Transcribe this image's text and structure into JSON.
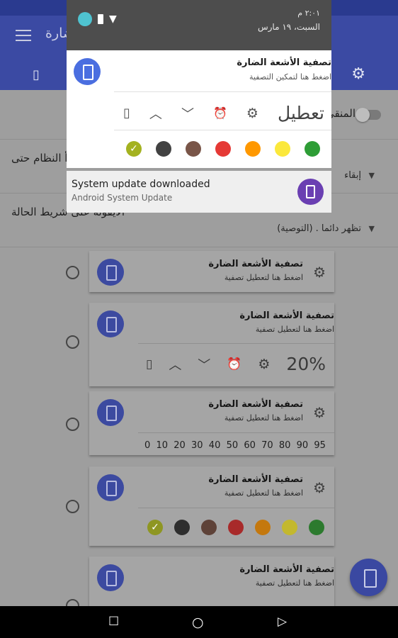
{
  "appbar": {
    "title": "ضارة"
  },
  "status_shade": {
    "time": "٢:٠١ م",
    "date": "السبت، ١٩ مارس"
  },
  "filter_notification": {
    "title": "تصفية الأشعة الضارة",
    "subtitle": "اضغط هنا لتمكين التصفية",
    "disable_label": "تعطيل",
    "colors": [
      "#a4b220",
      "#424242",
      "#795548",
      "#e53935",
      "#ff9800",
      "#fbe83c",
      "#2e9d36"
    ]
  },
  "system_notification": {
    "title": "System update downloaded",
    "app": "Android System Update"
  },
  "settings": {
    "toggle_label": "المنقي",
    "setting1_label": "أ النظام حتى",
    "setting1_value": "إبقاء",
    "setting2_label": "الأيقونة على شريط الحالة",
    "setting2_value": "تظهر دائما . (التوصية)"
  },
  "previews": [
    {
      "title": "تصفية الأشعة الضارة",
      "subtitle": "اضغط هنا لتعطيل تصفية"
    },
    {
      "title": "تصفية الأشعة الضارة",
      "subtitle": "اضغط هنا لتعطيل تصفية",
      "percent": "20%"
    },
    {
      "title": "تصفية الأشعة الضارة",
      "subtitle": "اضغط هنا لتعطيل تصفية",
      "scale": [
        "0",
        "10",
        "20",
        "30",
        "40",
        "50",
        "60",
        "70",
        "80",
        "90",
        "95"
      ]
    },
    {
      "title": "تصفية الأشعة الضارة",
      "subtitle": "اضغط هنا لتعطيل تصفية",
      "colors": [
        "#8e9622",
        "#2e2e2e",
        "#5e4238",
        "#a82a2a",
        "#c4780e",
        "#c3b82e",
        "#2c7a2e"
      ]
    },
    {
      "title": "تصفية الأشعة الضارة",
      "subtitle": "اضغط هنا لتعطيل تصفية"
    }
  ]
}
